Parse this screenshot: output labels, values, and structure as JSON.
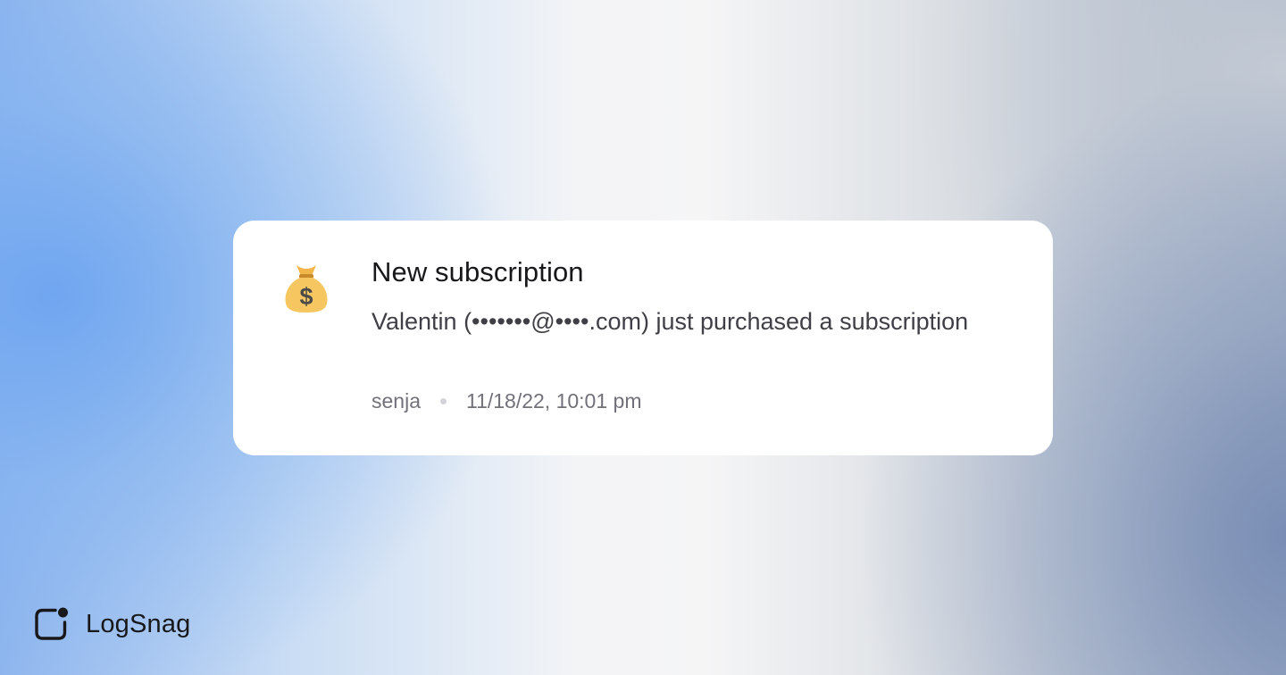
{
  "notification": {
    "icon": "money-bag-icon",
    "title": "New subscription",
    "message": "Valentin (•••••••@••••.com) just purchased a subscription",
    "channel": "senja",
    "timestamp": "11/18/22, 10:01 pm"
  },
  "brand": {
    "logo": "logsnag-logo-icon",
    "name": "LogSnag"
  },
  "colors": {
    "card_background": "#ffffff",
    "title_text": "#18181b",
    "body_text": "#3f3f46",
    "meta_text": "#71717a",
    "accent_blue": "#6ea5f0",
    "money_bag": "#f6c660"
  }
}
